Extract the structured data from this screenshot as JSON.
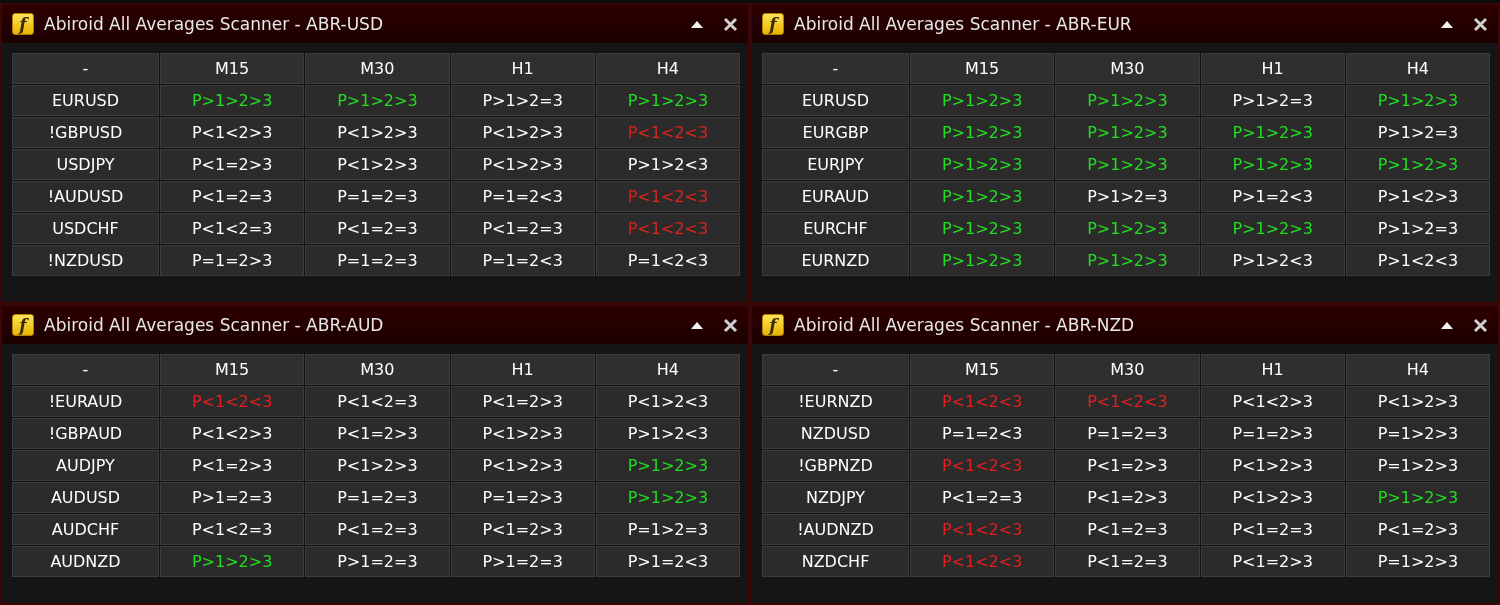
{
  "panels": [
    {
      "logo": "f",
      "title": "Abiroid All Averages Scanner - ABR-USD",
      "columns": [
        "-",
        "M15",
        "M30",
        "H1",
        "H4"
      ],
      "rows": [
        {
          "cells": [
            {
              "text": "EURUSD"
            },
            {
              "text": "P>1>2>3",
              "color": "#22dd22"
            },
            {
              "text": "P>1>2>3",
              "color": "#22dd22"
            },
            {
              "text": "P>1>2=3",
              "color": "#ffffff"
            },
            {
              "text": "P>1>2>3",
              "color": "#22dd22"
            }
          ]
        },
        {
          "cells": [
            {
              "text": "!GBPUSD"
            },
            {
              "text": "P<1<2>3",
              "color": "#ffffff"
            },
            {
              "text": "P<1>2>3",
              "color": "#ffffff"
            },
            {
              "text": "P<1>2>3",
              "color": "#ffffff"
            },
            {
              "text": "P<1<2<3",
              "color": "#e02020"
            }
          ]
        },
        {
          "cells": [
            {
              "text": "USDJPY"
            },
            {
              "text": "P<1=2>3",
              "color": "#ffffff"
            },
            {
              "text": "P<1>2>3",
              "color": "#ffffff"
            },
            {
              "text": "P<1>2>3",
              "color": "#ffffff"
            },
            {
              "text": "P>1>2<3",
              "color": "#ffffff"
            }
          ]
        },
        {
          "cells": [
            {
              "text": "!AUDUSD"
            },
            {
              "text": "P<1=2=3",
              "color": "#ffffff"
            },
            {
              "text": "P=1=2=3",
              "color": "#ffffff"
            },
            {
              "text": "P=1=2<3",
              "color": "#ffffff"
            },
            {
              "text": "P<1<2<3",
              "color": "#e02020"
            }
          ]
        },
        {
          "cells": [
            {
              "text": "USDCHF"
            },
            {
              "text": "P<1<2=3",
              "color": "#ffffff"
            },
            {
              "text": "P<1=2=3",
              "color": "#ffffff"
            },
            {
              "text": "P<1=2=3",
              "color": "#ffffff"
            },
            {
              "text": "P<1<2<3",
              "color": "#e02020"
            }
          ]
        },
        {
          "cells": [
            {
              "text": "!NZDUSD"
            },
            {
              "text": "P=1=2>3",
              "color": "#ffffff"
            },
            {
              "text": "P=1=2=3",
              "color": "#ffffff"
            },
            {
              "text": "P=1=2<3",
              "color": "#ffffff"
            },
            {
              "text": "P=1<2<3",
              "color": "#ffffff"
            }
          ]
        }
      ]
    },
    {
      "logo": "f",
      "title": "Abiroid All Averages Scanner - ABR-EUR",
      "columns": [
        "-",
        "M15",
        "M30",
        "H1",
        "H4"
      ],
      "rows": [
        {
          "cells": [
            {
              "text": "EURUSD"
            },
            {
              "text": "P>1>2>3",
              "color": "#22dd22"
            },
            {
              "text": "P>1>2>3",
              "color": "#22dd22"
            },
            {
              "text": "P>1>2=3",
              "color": "#ffffff"
            },
            {
              "text": "P>1>2>3",
              "color": "#22dd22"
            }
          ]
        },
        {
          "cells": [
            {
              "text": "EURGBP"
            },
            {
              "text": "P>1>2>3",
              "color": "#22dd22"
            },
            {
              "text": "P>1>2>3",
              "color": "#22dd22"
            },
            {
              "text": "P>1>2>3",
              "color": "#22dd22"
            },
            {
              "text": "P>1>2=3",
              "color": "#ffffff"
            }
          ]
        },
        {
          "cells": [
            {
              "text": "EURJPY"
            },
            {
              "text": "P>1>2>3",
              "color": "#22dd22"
            },
            {
              "text": "P>1>2>3",
              "color": "#22dd22"
            },
            {
              "text": "P>1>2>3",
              "color": "#22dd22"
            },
            {
              "text": "P>1>2>3",
              "color": "#22dd22"
            }
          ]
        },
        {
          "cells": [
            {
              "text": "EURAUD"
            },
            {
              "text": "P>1>2>3",
              "color": "#22dd22"
            },
            {
              "text": "P>1>2=3",
              "color": "#ffffff"
            },
            {
              "text": "P>1=2<3",
              "color": "#ffffff"
            },
            {
              "text": "P>1<2>3",
              "color": "#ffffff"
            }
          ]
        },
        {
          "cells": [
            {
              "text": "EURCHF"
            },
            {
              "text": "P>1>2>3",
              "color": "#22dd22"
            },
            {
              "text": "P>1>2>3",
              "color": "#22dd22"
            },
            {
              "text": "P>1>2>3",
              "color": "#22dd22"
            },
            {
              "text": "P>1>2=3",
              "color": "#ffffff"
            }
          ]
        },
        {
          "cells": [
            {
              "text": "EURNZD"
            },
            {
              "text": "P>1>2>3",
              "color": "#22dd22"
            },
            {
              "text": "P>1>2>3",
              "color": "#22dd22"
            },
            {
              "text": "P>1>2<3",
              "color": "#ffffff"
            },
            {
              "text": "P>1<2<3",
              "color": "#ffffff"
            }
          ]
        }
      ]
    },
    {
      "logo": "f",
      "title": "Abiroid All Averages Scanner - ABR-AUD",
      "columns": [
        "-",
        "M15",
        "M30",
        "H1",
        "H4"
      ],
      "rows": [
        {
          "cells": [
            {
              "text": "!EURAUD"
            },
            {
              "text": "P<1<2<3",
              "color": "#e02020"
            },
            {
              "text": "P<1<2=3",
              "color": "#ffffff"
            },
            {
              "text": "P<1=2>3",
              "color": "#ffffff"
            },
            {
              "text": "P<1>2<3",
              "color": "#ffffff"
            }
          ]
        },
        {
          "cells": [
            {
              "text": "!GBPAUD"
            },
            {
              "text": "P<1<2>3",
              "color": "#ffffff"
            },
            {
              "text": "P<1=2>3",
              "color": "#ffffff"
            },
            {
              "text": "P<1>2>3",
              "color": "#ffffff"
            },
            {
              "text": "P>1>2<3",
              "color": "#ffffff"
            }
          ]
        },
        {
          "cells": [
            {
              "text": "AUDJPY"
            },
            {
              "text": "P<1=2>3",
              "color": "#ffffff"
            },
            {
              "text": "P<1>2>3",
              "color": "#ffffff"
            },
            {
              "text": "P<1>2>3",
              "color": "#ffffff"
            },
            {
              "text": "P>1>2>3",
              "color": "#22dd22"
            }
          ]
        },
        {
          "cells": [
            {
              "text": "AUDUSD"
            },
            {
              "text": "P>1=2=3",
              "color": "#ffffff"
            },
            {
              "text": "P=1=2=3",
              "color": "#ffffff"
            },
            {
              "text": "P=1=2>3",
              "color": "#ffffff"
            },
            {
              "text": "P>1>2>3",
              "color": "#22dd22"
            }
          ]
        },
        {
          "cells": [
            {
              "text": "AUDCHF"
            },
            {
              "text": "P<1<2=3",
              "color": "#ffffff"
            },
            {
              "text": "P<1=2=3",
              "color": "#ffffff"
            },
            {
              "text": "P<1=2>3",
              "color": "#ffffff"
            },
            {
              "text": "P=1>2=3",
              "color": "#ffffff"
            }
          ]
        },
        {
          "cells": [
            {
              "text": "AUDNZD"
            },
            {
              "text": "P>1>2>3",
              "color": "#22dd22"
            },
            {
              "text": "P>1=2=3",
              "color": "#ffffff"
            },
            {
              "text": "P>1=2=3",
              "color": "#ffffff"
            },
            {
              "text": "P>1=2<3",
              "color": "#ffffff"
            }
          ]
        }
      ]
    },
    {
      "logo": "f",
      "title": "Abiroid All Averages Scanner - ABR-NZD",
      "columns": [
        "-",
        "M15",
        "M30",
        "H1",
        "H4"
      ],
      "rows": [
        {
          "cells": [
            {
              "text": "!EURNZD"
            },
            {
              "text": "P<1<2<3",
              "color": "#e02020"
            },
            {
              "text": "P<1<2<3",
              "color": "#e02020"
            },
            {
              "text": "P<1<2>3",
              "color": "#ffffff"
            },
            {
              "text": "P<1>2>3",
              "color": "#ffffff"
            }
          ]
        },
        {
          "cells": [
            {
              "text": "NZDUSD"
            },
            {
              "text": "P=1=2<3",
              "color": "#ffffff"
            },
            {
              "text": "P=1=2=3",
              "color": "#ffffff"
            },
            {
              "text": "P=1=2>3",
              "color": "#ffffff"
            },
            {
              "text": "P=1>2>3",
              "color": "#ffffff"
            }
          ]
        },
        {
          "cells": [
            {
              "text": "!GBPNZD"
            },
            {
              "text": "P<1<2<3",
              "color": "#e02020"
            },
            {
              "text": "P<1=2>3",
              "color": "#ffffff"
            },
            {
              "text": "P<1>2>3",
              "color": "#ffffff"
            },
            {
              "text": "P=1>2>3",
              "color": "#ffffff"
            }
          ]
        },
        {
          "cells": [
            {
              "text": "NZDJPY"
            },
            {
              "text": "P<1=2=3",
              "color": "#ffffff"
            },
            {
              "text": "P<1=2>3",
              "color": "#ffffff"
            },
            {
              "text": "P<1>2>3",
              "color": "#ffffff"
            },
            {
              "text": "P>1>2>3",
              "color": "#22dd22"
            }
          ]
        },
        {
          "cells": [
            {
              "text": "!AUDNZD"
            },
            {
              "text": "P<1<2<3",
              "color": "#e02020"
            },
            {
              "text": "P<1=2=3",
              "color": "#ffffff"
            },
            {
              "text": "P<1=2=3",
              "color": "#ffffff"
            },
            {
              "text": "P<1=2>3",
              "color": "#ffffff"
            }
          ]
        },
        {
          "cells": [
            {
              "text": "NZDCHF"
            },
            {
              "text": "P<1<2<3",
              "color": "#e02020"
            },
            {
              "text": "P<1=2=3",
              "color": "#ffffff"
            },
            {
              "text": "P<1=2>3",
              "color": "#ffffff"
            },
            {
              "text": "P=1>2>3",
              "color": "#ffffff"
            }
          ]
        }
      ]
    }
  ]
}
